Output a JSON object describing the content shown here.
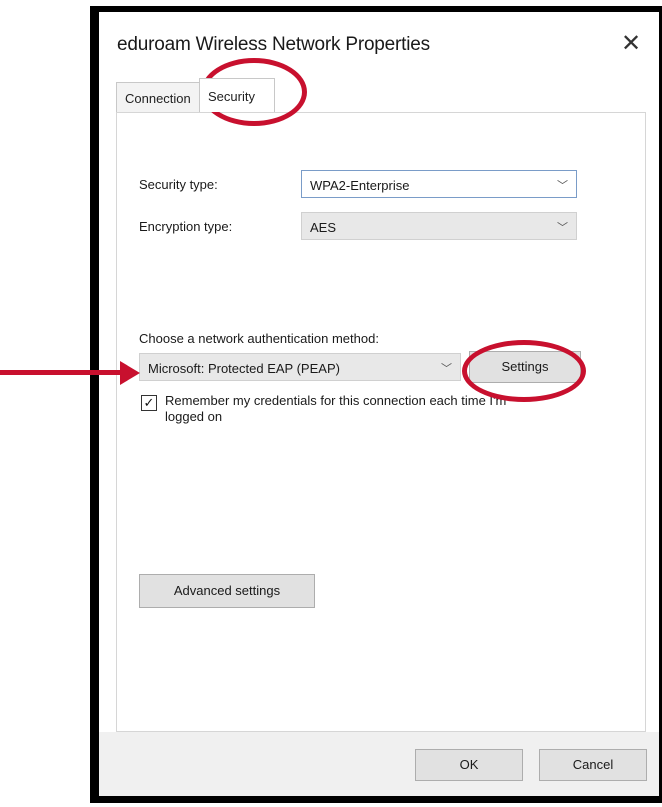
{
  "window": {
    "title": "eduroam Wireless Network Properties",
    "close_glyph": "✕"
  },
  "tabs": [
    {
      "label": "Connection",
      "active": false
    },
    {
      "label": "Security",
      "active": true
    }
  ],
  "security": {
    "security_type_label": "Security type:",
    "security_type_value": "WPA2-Enterprise",
    "encryption_type_label": "Encryption type:",
    "encryption_type_value": "AES",
    "auth_method_label": "Choose a network authentication method:",
    "auth_method_value": "Microsoft: Protected EAP (PEAP)",
    "settings_label": "Settings",
    "remember_checked": true,
    "remember_label": "Remember my credentials for this connection each time I'm logged on",
    "advanced_label": "Advanced settings"
  },
  "footer": {
    "ok_label": "OK",
    "cancel_label": "Cancel"
  },
  "icons": {
    "chevron": "chevron-down-icon",
    "close": "close-icon",
    "check": "check-icon"
  },
  "colors": {
    "highlight": "#c8102e",
    "accent_border": "#7a9cc8"
  }
}
